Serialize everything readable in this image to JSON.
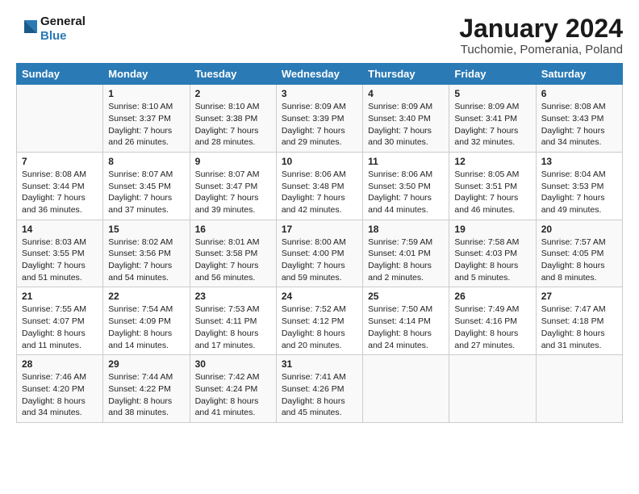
{
  "logo": {
    "line1": "General",
    "line2": "Blue"
  },
  "title": "January 2024",
  "subtitle": "Tuchomie, Pomerania, Poland",
  "days": [
    "Sunday",
    "Monday",
    "Tuesday",
    "Wednesday",
    "Thursday",
    "Friday",
    "Saturday"
  ],
  "weeks": [
    [
      {
        "day": "",
        "sunrise": "",
        "sunset": "",
        "daylight": ""
      },
      {
        "day": "1",
        "sunrise": "Sunrise: 8:10 AM",
        "sunset": "Sunset: 3:37 PM",
        "daylight": "Daylight: 7 hours and 26 minutes."
      },
      {
        "day": "2",
        "sunrise": "Sunrise: 8:10 AM",
        "sunset": "Sunset: 3:38 PM",
        "daylight": "Daylight: 7 hours and 28 minutes."
      },
      {
        "day": "3",
        "sunrise": "Sunrise: 8:09 AM",
        "sunset": "Sunset: 3:39 PM",
        "daylight": "Daylight: 7 hours and 29 minutes."
      },
      {
        "day": "4",
        "sunrise": "Sunrise: 8:09 AM",
        "sunset": "Sunset: 3:40 PM",
        "daylight": "Daylight: 7 hours and 30 minutes."
      },
      {
        "day": "5",
        "sunrise": "Sunrise: 8:09 AM",
        "sunset": "Sunset: 3:41 PM",
        "daylight": "Daylight: 7 hours and 32 minutes."
      },
      {
        "day": "6",
        "sunrise": "Sunrise: 8:08 AM",
        "sunset": "Sunset: 3:43 PM",
        "daylight": "Daylight: 7 hours and 34 minutes."
      }
    ],
    [
      {
        "day": "7",
        "sunrise": "Sunrise: 8:08 AM",
        "sunset": "Sunset: 3:44 PM",
        "daylight": "Daylight: 7 hours and 36 minutes."
      },
      {
        "day": "8",
        "sunrise": "Sunrise: 8:07 AM",
        "sunset": "Sunset: 3:45 PM",
        "daylight": "Daylight: 7 hours and 37 minutes."
      },
      {
        "day": "9",
        "sunrise": "Sunrise: 8:07 AM",
        "sunset": "Sunset: 3:47 PM",
        "daylight": "Daylight: 7 hours and 39 minutes."
      },
      {
        "day": "10",
        "sunrise": "Sunrise: 8:06 AM",
        "sunset": "Sunset: 3:48 PM",
        "daylight": "Daylight: 7 hours and 42 minutes."
      },
      {
        "day": "11",
        "sunrise": "Sunrise: 8:06 AM",
        "sunset": "Sunset: 3:50 PM",
        "daylight": "Daylight: 7 hours and 44 minutes."
      },
      {
        "day": "12",
        "sunrise": "Sunrise: 8:05 AM",
        "sunset": "Sunset: 3:51 PM",
        "daylight": "Daylight: 7 hours and 46 minutes."
      },
      {
        "day": "13",
        "sunrise": "Sunrise: 8:04 AM",
        "sunset": "Sunset: 3:53 PM",
        "daylight": "Daylight: 7 hours and 49 minutes."
      }
    ],
    [
      {
        "day": "14",
        "sunrise": "Sunrise: 8:03 AM",
        "sunset": "Sunset: 3:55 PM",
        "daylight": "Daylight: 7 hours and 51 minutes."
      },
      {
        "day": "15",
        "sunrise": "Sunrise: 8:02 AM",
        "sunset": "Sunset: 3:56 PM",
        "daylight": "Daylight: 7 hours and 54 minutes."
      },
      {
        "day": "16",
        "sunrise": "Sunrise: 8:01 AM",
        "sunset": "Sunset: 3:58 PM",
        "daylight": "Daylight: 7 hours and 56 minutes."
      },
      {
        "day": "17",
        "sunrise": "Sunrise: 8:00 AM",
        "sunset": "Sunset: 4:00 PM",
        "daylight": "Daylight: 7 hours and 59 minutes."
      },
      {
        "day": "18",
        "sunrise": "Sunrise: 7:59 AM",
        "sunset": "Sunset: 4:01 PM",
        "daylight": "Daylight: 8 hours and 2 minutes."
      },
      {
        "day": "19",
        "sunrise": "Sunrise: 7:58 AM",
        "sunset": "Sunset: 4:03 PM",
        "daylight": "Daylight: 8 hours and 5 minutes."
      },
      {
        "day": "20",
        "sunrise": "Sunrise: 7:57 AM",
        "sunset": "Sunset: 4:05 PM",
        "daylight": "Daylight: 8 hours and 8 minutes."
      }
    ],
    [
      {
        "day": "21",
        "sunrise": "Sunrise: 7:55 AM",
        "sunset": "Sunset: 4:07 PM",
        "daylight": "Daylight: 8 hours and 11 minutes."
      },
      {
        "day": "22",
        "sunrise": "Sunrise: 7:54 AM",
        "sunset": "Sunset: 4:09 PM",
        "daylight": "Daylight: 8 hours and 14 minutes."
      },
      {
        "day": "23",
        "sunrise": "Sunrise: 7:53 AM",
        "sunset": "Sunset: 4:11 PM",
        "daylight": "Daylight: 8 hours and 17 minutes."
      },
      {
        "day": "24",
        "sunrise": "Sunrise: 7:52 AM",
        "sunset": "Sunset: 4:12 PM",
        "daylight": "Daylight: 8 hours and 20 minutes."
      },
      {
        "day": "25",
        "sunrise": "Sunrise: 7:50 AM",
        "sunset": "Sunset: 4:14 PM",
        "daylight": "Daylight: 8 hours and 24 minutes."
      },
      {
        "day": "26",
        "sunrise": "Sunrise: 7:49 AM",
        "sunset": "Sunset: 4:16 PM",
        "daylight": "Daylight: 8 hours and 27 minutes."
      },
      {
        "day": "27",
        "sunrise": "Sunrise: 7:47 AM",
        "sunset": "Sunset: 4:18 PM",
        "daylight": "Daylight: 8 hours and 31 minutes."
      }
    ],
    [
      {
        "day": "28",
        "sunrise": "Sunrise: 7:46 AM",
        "sunset": "Sunset: 4:20 PM",
        "daylight": "Daylight: 8 hours and 34 minutes."
      },
      {
        "day": "29",
        "sunrise": "Sunrise: 7:44 AM",
        "sunset": "Sunset: 4:22 PM",
        "daylight": "Daylight: 8 hours and 38 minutes."
      },
      {
        "day": "30",
        "sunrise": "Sunrise: 7:42 AM",
        "sunset": "Sunset: 4:24 PM",
        "daylight": "Daylight: 8 hours and 41 minutes."
      },
      {
        "day": "31",
        "sunrise": "Sunrise: 7:41 AM",
        "sunset": "Sunset: 4:26 PM",
        "daylight": "Daylight: 8 hours and 45 minutes."
      },
      {
        "day": "",
        "sunrise": "",
        "sunset": "",
        "daylight": ""
      },
      {
        "day": "",
        "sunrise": "",
        "sunset": "",
        "daylight": ""
      },
      {
        "day": "",
        "sunrise": "",
        "sunset": "",
        "daylight": ""
      }
    ]
  ]
}
